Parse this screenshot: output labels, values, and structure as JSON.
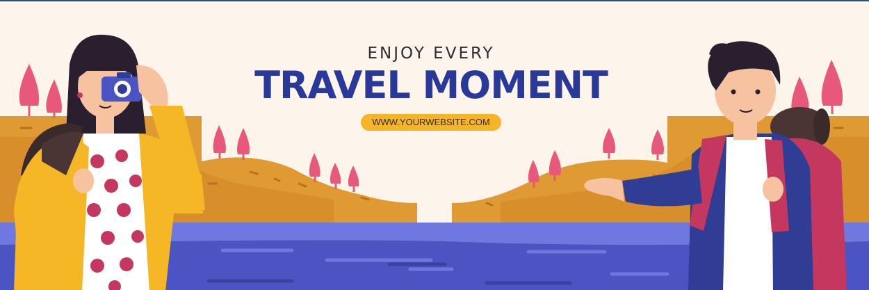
{
  "banner": {
    "subtitle": "ENJOY EVERY",
    "title": "TRAVEL MOMENT",
    "url": "WWW.YOURWEBSITE.COM"
  },
  "colors": {
    "background": "#fdf4ec",
    "title": "#28399a",
    "pill": "#f4b527",
    "hills": "#e09a34",
    "hills_dark": "#cc8526",
    "water": "#4a54c2",
    "water_light": "#6d79de",
    "trees": "#e8587a",
    "jacket_yellow": "#f6b726",
    "jacket_blue": "#2f3d94",
    "backpack_pink": "#c4385f"
  },
  "illustration": {
    "left_character": "woman-with-camera-icon",
    "right_character": "man-with-backpack-icon",
    "trees": "pink-tree-icon",
    "camera": "camera-icon"
  }
}
